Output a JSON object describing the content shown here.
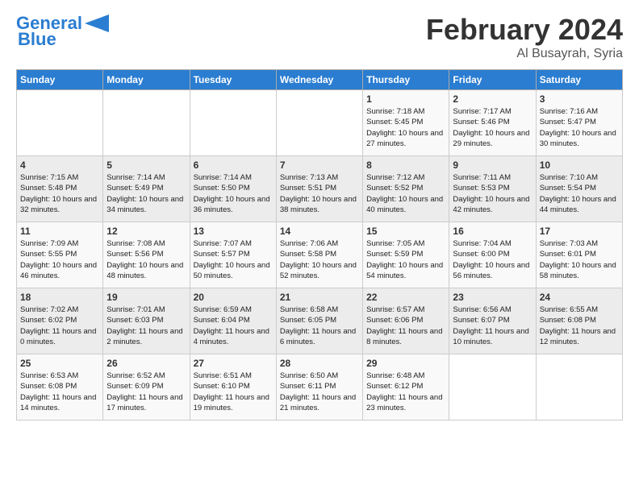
{
  "header": {
    "logo_general": "General",
    "logo_blue": "Blue",
    "month_year": "February 2024",
    "location": "Al Busayrah, Syria"
  },
  "days_of_week": [
    "Sunday",
    "Monday",
    "Tuesday",
    "Wednesday",
    "Thursday",
    "Friday",
    "Saturday"
  ],
  "weeks": [
    [
      null,
      null,
      null,
      null,
      {
        "day": 1,
        "sunrise": "7:18 AM",
        "sunset": "5:45 PM",
        "daylight": "10 hours and 27 minutes."
      },
      {
        "day": 2,
        "sunrise": "7:17 AM",
        "sunset": "5:46 PM",
        "daylight": "10 hours and 29 minutes."
      },
      {
        "day": 3,
        "sunrise": "7:16 AM",
        "sunset": "5:47 PM",
        "daylight": "10 hours and 30 minutes."
      }
    ],
    [
      {
        "day": 4,
        "sunrise": "7:15 AM",
        "sunset": "5:48 PM",
        "daylight": "10 hours and 32 minutes."
      },
      {
        "day": 5,
        "sunrise": "7:14 AM",
        "sunset": "5:49 PM",
        "daylight": "10 hours and 34 minutes."
      },
      {
        "day": 6,
        "sunrise": "7:14 AM",
        "sunset": "5:50 PM",
        "daylight": "10 hours and 36 minutes."
      },
      {
        "day": 7,
        "sunrise": "7:13 AM",
        "sunset": "5:51 PM",
        "daylight": "10 hours and 38 minutes."
      },
      {
        "day": 8,
        "sunrise": "7:12 AM",
        "sunset": "5:52 PM",
        "daylight": "10 hours and 40 minutes."
      },
      {
        "day": 9,
        "sunrise": "7:11 AM",
        "sunset": "5:53 PM",
        "daylight": "10 hours and 42 minutes."
      },
      {
        "day": 10,
        "sunrise": "7:10 AM",
        "sunset": "5:54 PM",
        "daylight": "10 hours and 44 minutes."
      }
    ],
    [
      {
        "day": 11,
        "sunrise": "7:09 AM",
        "sunset": "5:55 PM",
        "daylight": "10 hours and 46 minutes."
      },
      {
        "day": 12,
        "sunrise": "7:08 AM",
        "sunset": "5:56 PM",
        "daylight": "10 hours and 48 minutes."
      },
      {
        "day": 13,
        "sunrise": "7:07 AM",
        "sunset": "5:57 PM",
        "daylight": "10 hours and 50 minutes."
      },
      {
        "day": 14,
        "sunrise": "7:06 AM",
        "sunset": "5:58 PM",
        "daylight": "10 hours and 52 minutes."
      },
      {
        "day": 15,
        "sunrise": "7:05 AM",
        "sunset": "5:59 PM",
        "daylight": "10 hours and 54 minutes."
      },
      {
        "day": 16,
        "sunrise": "7:04 AM",
        "sunset": "6:00 PM",
        "daylight": "10 hours and 56 minutes."
      },
      {
        "day": 17,
        "sunrise": "7:03 AM",
        "sunset": "6:01 PM",
        "daylight": "10 hours and 58 minutes."
      }
    ],
    [
      {
        "day": 18,
        "sunrise": "7:02 AM",
        "sunset": "6:02 PM",
        "daylight": "11 hours and 0 minutes."
      },
      {
        "day": 19,
        "sunrise": "7:01 AM",
        "sunset": "6:03 PM",
        "daylight": "11 hours and 2 minutes."
      },
      {
        "day": 20,
        "sunrise": "6:59 AM",
        "sunset": "6:04 PM",
        "daylight": "11 hours and 4 minutes."
      },
      {
        "day": 21,
        "sunrise": "6:58 AM",
        "sunset": "6:05 PM",
        "daylight": "11 hours and 6 minutes."
      },
      {
        "day": 22,
        "sunrise": "6:57 AM",
        "sunset": "6:06 PM",
        "daylight": "11 hours and 8 minutes."
      },
      {
        "day": 23,
        "sunrise": "6:56 AM",
        "sunset": "6:07 PM",
        "daylight": "11 hours and 10 minutes."
      },
      {
        "day": 24,
        "sunrise": "6:55 AM",
        "sunset": "6:08 PM",
        "daylight": "11 hours and 12 minutes."
      }
    ],
    [
      {
        "day": 25,
        "sunrise": "6:53 AM",
        "sunset": "6:08 PM",
        "daylight": "11 hours and 14 minutes."
      },
      {
        "day": 26,
        "sunrise": "6:52 AM",
        "sunset": "6:09 PM",
        "daylight": "11 hours and 17 minutes."
      },
      {
        "day": 27,
        "sunrise": "6:51 AM",
        "sunset": "6:10 PM",
        "daylight": "11 hours and 19 minutes."
      },
      {
        "day": 28,
        "sunrise": "6:50 AM",
        "sunset": "6:11 PM",
        "daylight": "11 hours and 21 minutes."
      },
      {
        "day": 29,
        "sunrise": "6:48 AM",
        "sunset": "6:12 PM",
        "daylight": "11 hours and 23 minutes."
      },
      null,
      null
    ]
  ]
}
